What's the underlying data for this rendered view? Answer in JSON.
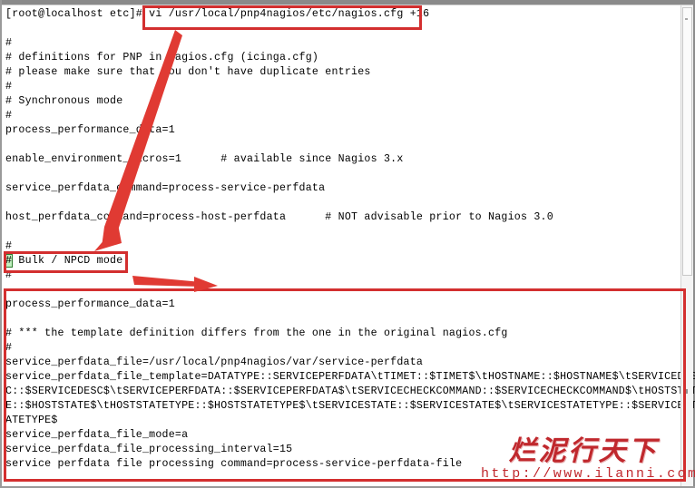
{
  "window": {
    "kind": "terminal-window",
    "scrollbar": {
      "orientation": "vertical",
      "thumb_label": ""
    }
  },
  "terminal": {
    "prompt": "[root@localhost etc]#",
    "command": "vi /usr/local/pnp4nagios/etc/nagios.cfg +16",
    "cursor_char": "#",
    "lines": [
      {
        "id": "l01",
        "text": "[root@localhost etc]# vi /usr/local/pnp4nagios/etc/nagios.cfg +16"
      },
      {
        "id": "l02",
        "text": ""
      },
      {
        "id": "l03",
        "text": "#"
      },
      {
        "id": "l04",
        "text": "# definitions for PNP in nagios.cfg (icinga.cfg)"
      },
      {
        "id": "l05",
        "text": "# please make sure that you don't have duplicate entries"
      },
      {
        "id": "l06",
        "text": "#"
      },
      {
        "id": "l07",
        "text": "# Synchronous mode"
      },
      {
        "id": "l08",
        "text": "#"
      },
      {
        "id": "l09",
        "text": "process_performance_data=1"
      },
      {
        "id": "l10",
        "text": ""
      },
      {
        "id": "l11",
        "text": "enable_environment_macros=1      # available since Nagios 3.x"
      },
      {
        "id": "l12",
        "text": ""
      },
      {
        "id": "l13",
        "text": "service_perfdata_command=process-service-perfdata"
      },
      {
        "id": "l14",
        "text": ""
      },
      {
        "id": "l15",
        "text": "host_perfdata_command=process-host-perfdata      # NOT advisable prior to Nagios 3.0"
      },
      {
        "id": "l16",
        "text": ""
      },
      {
        "id": "l17",
        "text": "#"
      },
      {
        "id": "l18",
        "text": "# Bulk / NPCD mode",
        "cursor": true
      },
      {
        "id": "l19",
        "text": "#"
      },
      {
        "id": "l20",
        "text": ""
      },
      {
        "id": "l21",
        "text": "process_performance_data=1"
      },
      {
        "id": "l22",
        "text": ""
      },
      {
        "id": "l23",
        "text": "# *** the template definition differs from the one in the original nagios.cfg"
      },
      {
        "id": "l24",
        "text": "#"
      },
      {
        "id": "l25",
        "text": "service_perfdata_file=/usr/local/pnp4nagios/var/service-perfdata"
      },
      {
        "id": "l26",
        "text": "service_perfdata_file_template=DATATYPE::SERVICEPERFDATA\\tTIMET::$TIMET$\\tHOSTNAME::$HOSTNAME$\\tSERVICEDES"
      },
      {
        "id": "l27",
        "text": "C::$SERVICEDESC$\\tSERVICEPERFDATA::$SERVICEPERFDATA$\\tSERVICECHECKCOMMAND::$SERVICECHECKCOMMAND$\\tHOSTSTAT"
      },
      {
        "id": "l28",
        "text": "E::$HOSTSTATE$\\tHOSTSTATETYPE::$HOSTSTATETYPE$\\tSERVICESTATE::$SERVICESTATE$\\tSERVICESTATETYPE::$SERVICEST"
      },
      {
        "id": "l29",
        "text": "ATETYPE$"
      },
      {
        "id": "l30",
        "text": "service_perfdata_file_mode=a"
      },
      {
        "id": "l31",
        "text": "service_perfdata_file_processing_interval=15"
      },
      {
        "id": "l32",
        "text": "service perfdata file processing command=process-service-perfdata-file"
      }
    ]
  },
  "annotations": {
    "accent_color": "#d32f2f",
    "boxes": [
      {
        "id": "box-cmd",
        "label": "vi-command-highlight"
      },
      {
        "id": "box-bulk",
        "label": "bulk-npcd-mode-highlight"
      },
      {
        "id": "box-block",
        "label": "bulk-npcd-config-block-highlight"
      }
    ],
    "arrows": [
      {
        "id": "arrow-diagonal",
        "label": "points-from-command-to-bulk-mode"
      },
      {
        "id": "arrow-horizontal",
        "label": "points-from-bulk-mode-to-config-block"
      }
    ]
  },
  "watermark": {
    "chinese": "烂泥行天下",
    "url": "http://www.ilanni.com",
    "color": "#c0282d"
  }
}
